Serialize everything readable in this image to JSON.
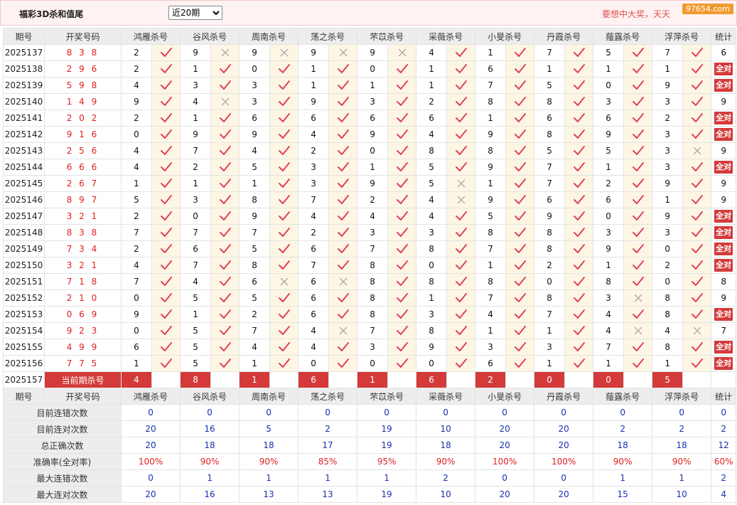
{
  "header": {
    "title": "福彩3D杀和值尾",
    "period_select": "近20期",
    "slogan": "要想中大奖，天天",
    "watermark": "97654.com"
  },
  "columns": {
    "issue": "期号",
    "draw": "开奖号码",
    "experts": [
      "鸿雁杀号",
      "谷风杀号",
      "周南杀号",
      "荡之杀号",
      "芣苡杀号",
      "采薇杀号",
      "小旻杀号",
      "丹霞杀号",
      "薤露杀号",
      "浮萍杀号"
    ],
    "stats": "统计"
  },
  "all_correct_label": "全对",
  "rows": [
    {
      "issue": "2025137",
      "draw": "8 3 8",
      "kills": [
        [
          "2",
          true
        ],
        [
          "9",
          false
        ],
        [
          "9",
          false
        ],
        [
          "9",
          false
        ],
        [
          "9",
          false
        ],
        [
          "4",
          true
        ],
        [
          "1",
          true
        ],
        [
          "7",
          true
        ],
        [
          "5",
          true
        ],
        [
          "7",
          true
        ]
      ],
      "stat": "6"
    },
    {
      "issue": "2025138",
      "draw": "2 9 6",
      "kills": [
        [
          "2",
          true
        ],
        [
          "1",
          true
        ],
        [
          "0",
          true
        ],
        [
          "1",
          true
        ],
        [
          "0",
          true
        ],
        [
          "1",
          true
        ],
        [
          "6",
          true
        ],
        [
          "1",
          true
        ],
        [
          "1",
          true
        ],
        [
          "1",
          true
        ]
      ],
      "stat": "全对"
    },
    {
      "issue": "2025139",
      "draw": "5 9 8",
      "kills": [
        [
          "4",
          true
        ],
        [
          "3",
          true
        ],
        [
          "3",
          true
        ],
        [
          "1",
          true
        ],
        [
          "1",
          true
        ],
        [
          "1",
          true
        ],
        [
          "7",
          true
        ],
        [
          "5",
          true
        ],
        [
          "0",
          true
        ],
        [
          "9",
          true
        ]
      ],
      "stat": "全对"
    },
    {
      "issue": "2025140",
      "draw": "1 4 9",
      "kills": [
        [
          "9",
          true
        ],
        [
          "4",
          false
        ],
        [
          "3",
          true
        ],
        [
          "9",
          true
        ],
        [
          "3",
          true
        ],
        [
          "2",
          true
        ],
        [
          "8",
          true
        ],
        [
          "8",
          true
        ],
        [
          "3",
          true
        ],
        [
          "3",
          true
        ]
      ],
      "stat": "9"
    },
    {
      "issue": "2025141",
      "draw": "2 0 2",
      "kills": [
        [
          "2",
          true
        ],
        [
          "1",
          true
        ],
        [
          "6",
          true
        ],
        [
          "6",
          true
        ],
        [
          "6",
          true
        ],
        [
          "6",
          true
        ],
        [
          "1",
          true
        ],
        [
          "6",
          true
        ],
        [
          "6",
          true
        ],
        [
          "2",
          true
        ]
      ],
      "stat": "全对"
    },
    {
      "issue": "2025142",
      "draw": "9 1 6",
      "kills": [
        [
          "0",
          true
        ],
        [
          "9",
          true
        ],
        [
          "9",
          true
        ],
        [
          "4",
          true
        ],
        [
          "9",
          true
        ],
        [
          "4",
          true
        ],
        [
          "9",
          true
        ],
        [
          "8",
          true
        ],
        [
          "9",
          true
        ],
        [
          "3",
          true
        ]
      ],
      "stat": "全对"
    },
    {
      "issue": "2025143",
      "draw": "2 5 6",
      "kills": [
        [
          "4",
          true
        ],
        [
          "7",
          true
        ],
        [
          "4",
          true
        ],
        [
          "2",
          true
        ],
        [
          "0",
          true
        ],
        [
          "8",
          true
        ],
        [
          "8",
          true
        ],
        [
          "5",
          true
        ],
        [
          "5",
          true
        ],
        [
          "3",
          false
        ]
      ],
      "stat": "9"
    },
    {
      "issue": "2025144",
      "draw": "6 6 6",
      "kills": [
        [
          "4",
          true
        ],
        [
          "2",
          true
        ],
        [
          "5",
          true
        ],
        [
          "3",
          true
        ],
        [
          "1",
          true
        ],
        [
          "5",
          true
        ],
        [
          "9",
          true
        ],
        [
          "7",
          true
        ],
        [
          "1",
          true
        ],
        [
          "3",
          true
        ]
      ],
      "stat": "全对"
    },
    {
      "issue": "2025145",
      "draw": "2 6 7",
      "kills": [
        [
          "1",
          true
        ],
        [
          "1",
          true
        ],
        [
          "1",
          true
        ],
        [
          "3",
          true
        ],
        [
          "9",
          true
        ],
        [
          "5",
          false
        ],
        [
          "1",
          true
        ],
        [
          "7",
          true
        ],
        [
          "2",
          true
        ],
        [
          "9",
          true
        ]
      ],
      "stat": "9"
    },
    {
      "issue": "2025146",
      "draw": "8 9 7",
      "kills": [
        [
          "5",
          true
        ],
        [
          "3",
          true
        ],
        [
          "8",
          true
        ],
        [
          "7",
          true
        ],
        [
          "2",
          true
        ],
        [
          "4",
          false
        ],
        [
          "9",
          true
        ],
        [
          "6",
          true
        ],
        [
          "6",
          true
        ],
        [
          "1",
          true
        ]
      ],
      "stat": "9"
    },
    {
      "issue": "2025147",
      "draw": "3 2 1",
      "kills": [
        [
          "2",
          true
        ],
        [
          "0",
          true
        ],
        [
          "9",
          true
        ],
        [
          "4",
          true
        ],
        [
          "4",
          true
        ],
        [
          "4",
          true
        ],
        [
          "5",
          true
        ],
        [
          "9",
          true
        ],
        [
          "0",
          true
        ],
        [
          "9",
          true
        ]
      ],
      "stat": "全对"
    },
    {
      "issue": "2025148",
      "draw": "8 3 8",
      "kills": [
        [
          "7",
          true
        ],
        [
          "7",
          true
        ],
        [
          "7",
          true
        ],
        [
          "2",
          true
        ],
        [
          "3",
          true
        ],
        [
          "3",
          true
        ],
        [
          "8",
          true
        ],
        [
          "8",
          true
        ],
        [
          "3",
          true
        ],
        [
          "3",
          true
        ]
      ],
      "stat": "全对"
    },
    {
      "issue": "2025149",
      "draw": "7 3 4",
      "kills": [
        [
          "2",
          true
        ],
        [
          "6",
          true
        ],
        [
          "5",
          true
        ],
        [
          "6",
          true
        ],
        [
          "7",
          true
        ],
        [
          "8",
          true
        ],
        [
          "7",
          true
        ],
        [
          "8",
          true
        ],
        [
          "9",
          true
        ],
        [
          "0",
          true
        ]
      ],
      "stat": "全对"
    },
    {
      "issue": "2025150",
      "draw": "3 2 1",
      "kills": [
        [
          "4",
          true
        ],
        [
          "7",
          true
        ],
        [
          "8",
          true
        ],
        [
          "7",
          true
        ],
        [
          "8",
          true
        ],
        [
          "0",
          true
        ],
        [
          "1",
          true
        ],
        [
          "2",
          true
        ],
        [
          "1",
          true
        ],
        [
          "2",
          true
        ]
      ],
      "stat": "全对"
    },
    {
      "issue": "2025151",
      "draw": "7 1 8",
      "kills": [
        [
          "7",
          true
        ],
        [
          "4",
          true
        ],
        [
          "6",
          false
        ],
        [
          "6",
          false
        ],
        [
          "8",
          true
        ],
        [
          "8",
          true
        ],
        [
          "8",
          true
        ],
        [
          "0",
          true
        ],
        [
          "8",
          true
        ],
        [
          "0",
          true
        ]
      ],
      "stat": "8"
    },
    {
      "issue": "2025152",
      "draw": "2 1 0",
      "kills": [
        [
          "0",
          true
        ],
        [
          "5",
          true
        ],
        [
          "5",
          true
        ],
        [
          "6",
          true
        ],
        [
          "8",
          true
        ],
        [
          "1",
          true
        ],
        [
          "7",
          true
        ],
        [
          "8",
          true
        ],
        [
          "3",
          false
        ],
        [
          "8",
          true
        ]
      ],
      "stat": "9"
    },
    {
      "issue": "2025153",
      "draw": "0 6 9",
      "kills": [
        [
          "9",
          true
        ],
        [
          "1",
          true
        ],
        [
          "2",
          true
        ],
        [
          "6",
          true
        ],
        [
          "8",
          true
        ],
        [
          "3",
          true
        ],
        [
          "4",
          true
        ],
        [
          "7",
          true
        ],
        [
          "4",
          true
        ],
        [
          "8",
          true
        ]
      ],
      "stat": "全对"
    },
    {
      "issue": "2025154",
      "draw": "9 2 3",
      "kills": [
        [
          "0",
          true
        ],
        [
          "5",
          true
        ],
        [
          "7",
          true
        ],
        [
          "4",
          false
        ],
        [
          "7",
          true
        ],
        [
          "8",
          true
        ],
        [
          "1",
          true
        ],
        [
          "1",
          true
        ],
        [
          "4",
          false
        ],
        [
          "4",
          false
        ]
      ],
      "stat": "7"
    },
    {
      "issue": "2025155",
      "draw": "4 9 9",
      "kills": [
        [
          "6",
          true
        ],
        [
          "5",
          true
        ],
        [
          "4",
          true
        ],
        [
          "4",
          true
        ],
        [
          "3",
          true
        ],
        [
          "9",
          true
        ],
        [
          "3",
          true
        ],
        [
          "3",
          true
        ],
        [
          "7",
          true
        ],
        [
          "8",
          true
        ]
      ],
      "stat": "全对"
    },
    {
      "issue": "2025156",
      "draw": "7 7 5",
      "kills": [
        [
          "1",
          true
        ],
        [
          "5",
          true
        ],
        [
          "1",
          true
        ],
        [
          "0",
          true
        ],
        [
          "0",
          true
        ],
        [
          "0",
          true
        ],
        [
          "6",
          true
        ],
        [
          "1",
          true
        ],
        [
          "1",
          true
        ],
        [
          "1",
          true
        ]
      ],
      "stat": "全对"
    }
  ],
  "current": {
    "issue": "2025157",
    "label": "当前期杀号",
    "values": [
      "4",
      "8",
      "1",
      "6",
      "1",
      "6",
      "2",
      "0",
      "0",
      "5"
    ]
  },
  "summary": [
    {
      "label": "目前连错次数",
      "values": [
        "0",
        "0",
        "0",
        "0",
        "0",
        "0",
        "0",
        "0",
        "0",
        "0"
      ],
      "stat": "0"
    },
    {
      "label": "目前连对次数",
      "values": [
        "20",
        "16",
        "5",
        "2",
        "19",
        "10",
        "20",
        "20",
        "2",
        "2"
      ],
      "stat": "2"
    },
    {
      "label": "总正确次数",
      "values": [
        "20",
        "18",
        "18",
        "17",
        "19",
        "18",
        "20",
        "20",
        "18",
        "18"
      ],
      "stat": "12"
    },
    {
      "label": "准确率(全对率)",
      "values": [
        "100%",
        "90%",
        "90%",
        "85%",
        "95%",
        "90%",
        "100%",
        "100%",
        "90%",
        "90%"
      ],
      "stat": "60%",
      "pct": true
    },
    {
      "label": "最大连错次数",
      "values": [
        "0",
        "1",
        "1",
        "1",
        "1",
        "2",
        "0",
        "0",
        "1",
        "1"
      ],
      "stat": "2"
    },
    {
      "label": "最大连对次数",
      "values": [
        "20",
        "16",
        "13",
        "13",
        "19",
        "10",
        "20",
        "20",
        "15",
        "10"
      ],
      "stat": "4"
    }
  ],
  "colors": {
    "accent": "#d43a3a",
    "check": "#e0405a",
    "cross": "#aaaaaa",
    "blue": "#1b2fb0"
  }
}
